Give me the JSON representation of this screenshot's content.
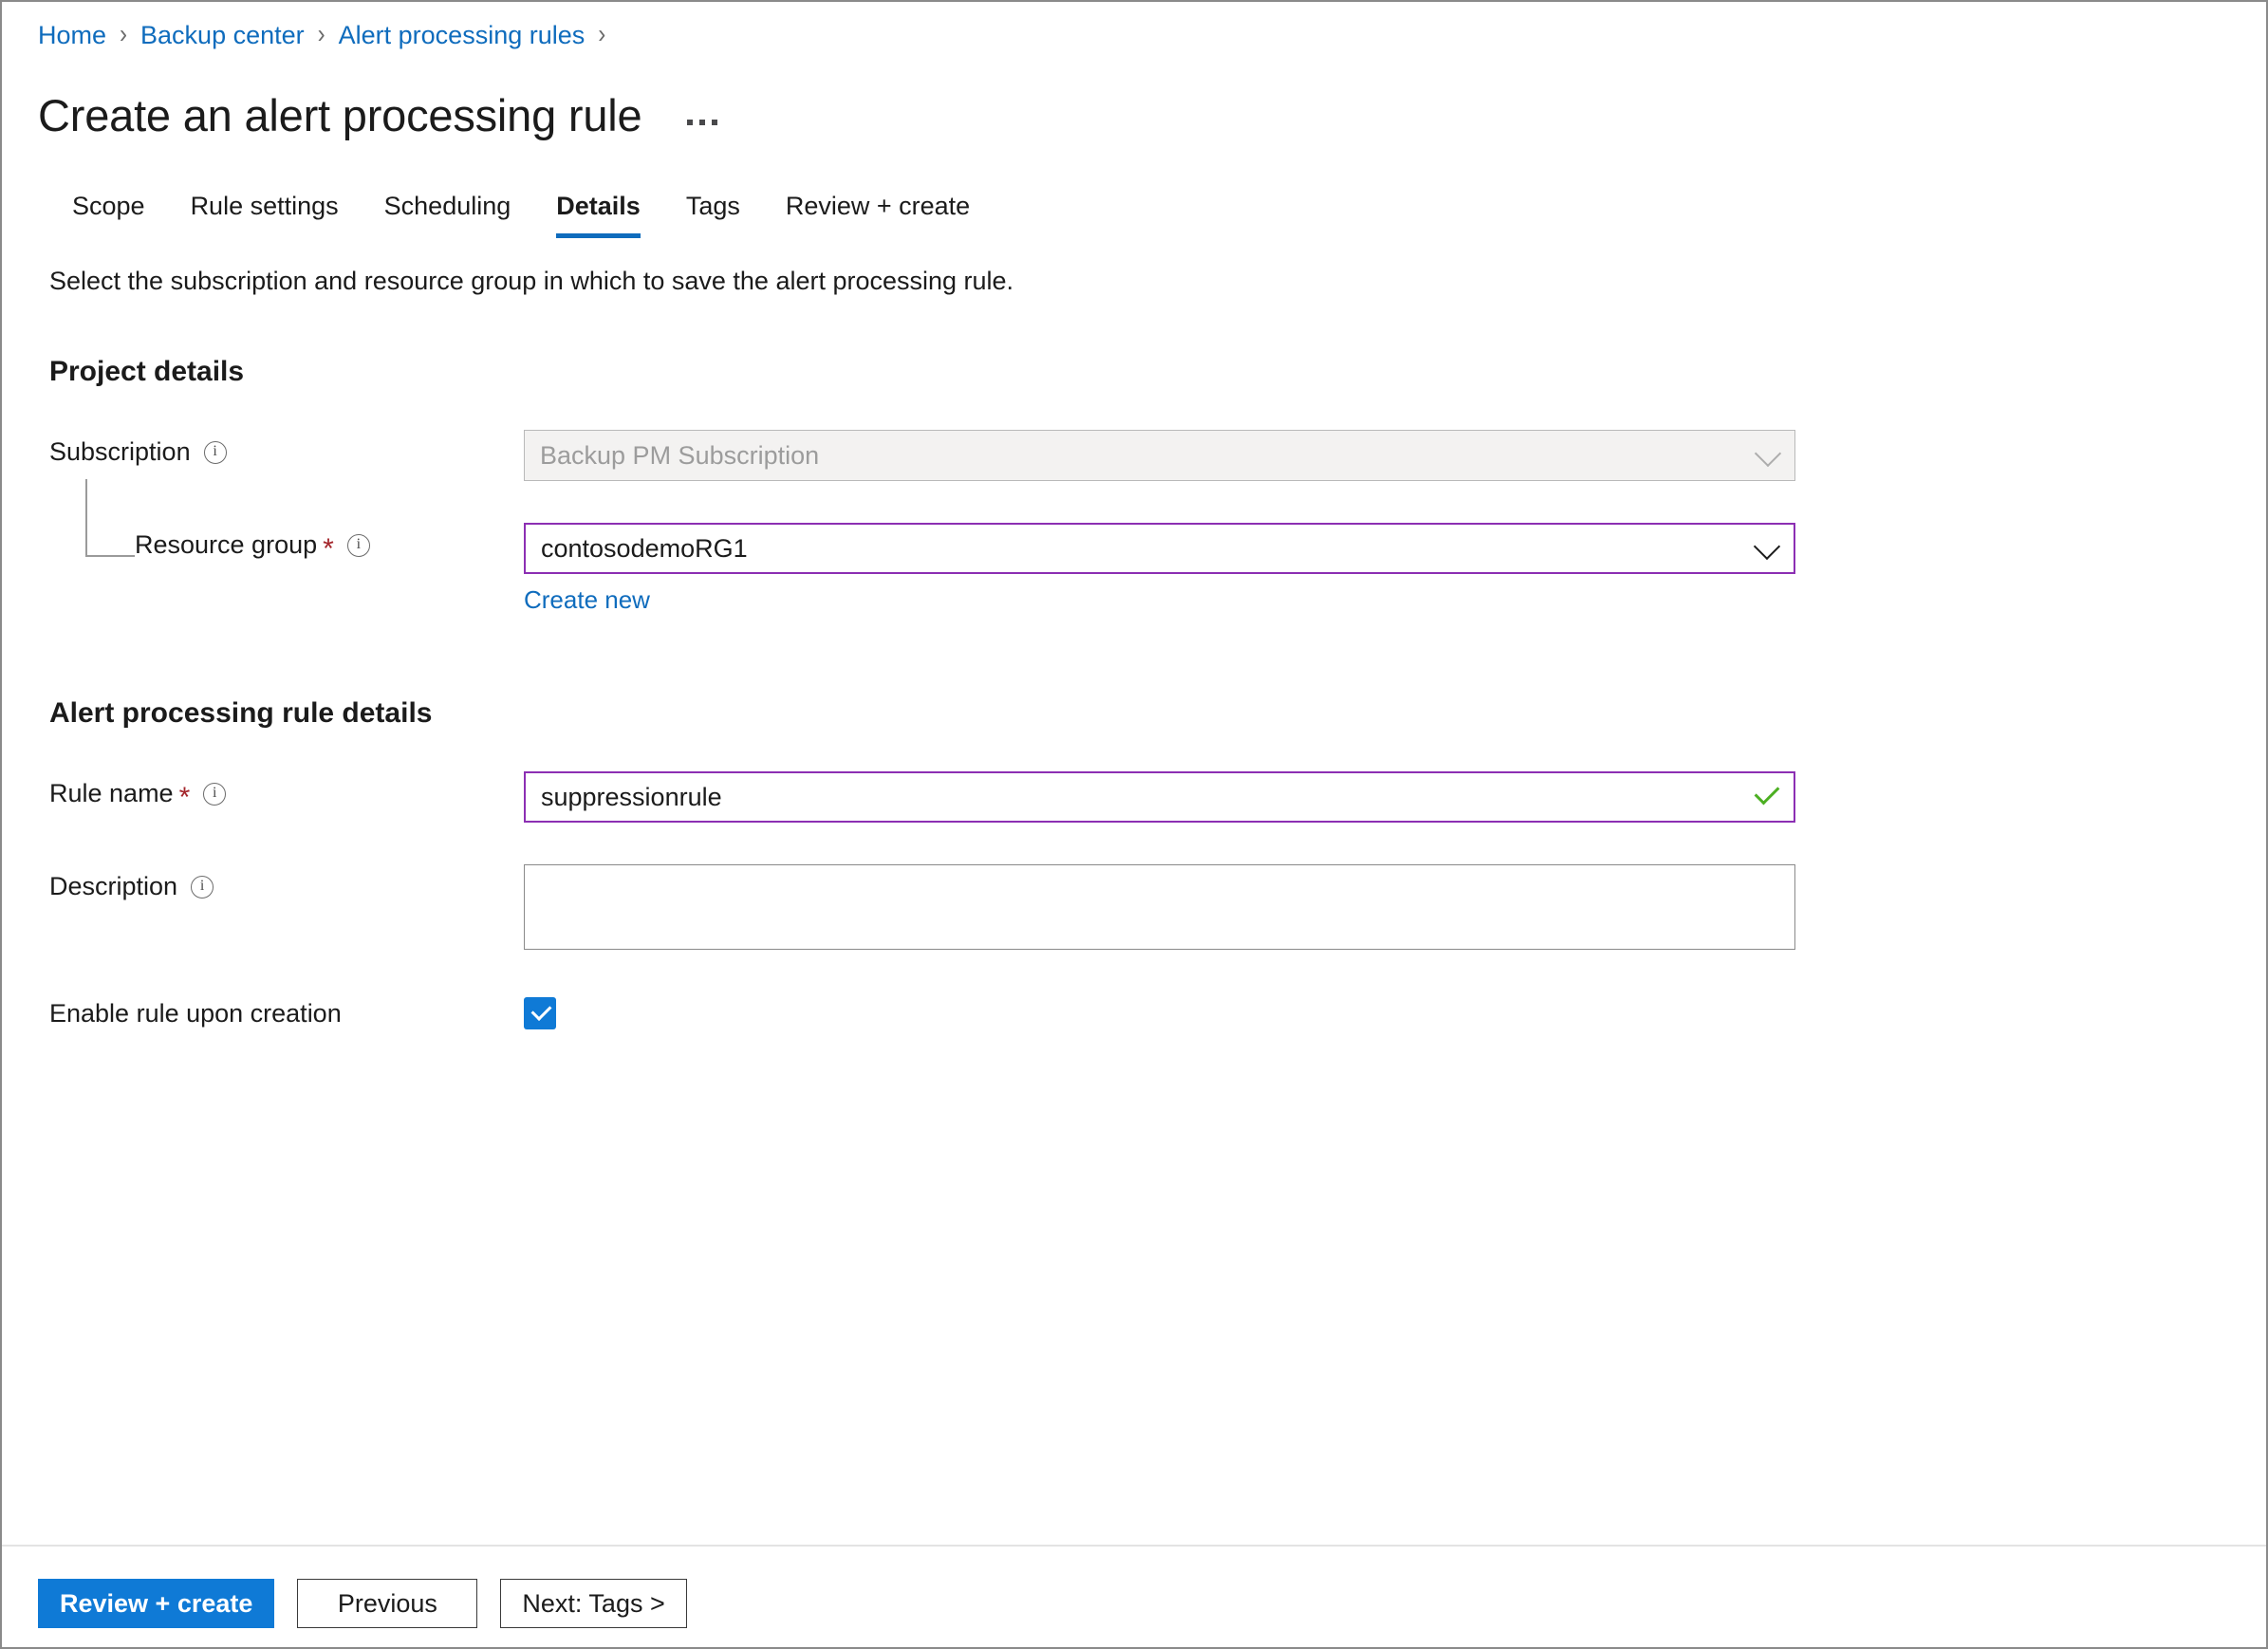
{
  "breadcrumb": {
    "items": [
      {
        "label": "Home"
      },
      {
        "label": "Backup center"
      },
      {
        "label": "Alert processing rules"
      }
    ],
    "separator": "›"
  },
  "header": {
    "title": "Create an alert processing rule",
    "more_menu": "more-options"
  },
  "tabs": [
    {
      "label": "Scope",
      "active": false
    },
    {
      "label": "Rule settings",
      "active": false
    },
    {
      "label": "Scheduling",
      "active": false
    },
    {
      "label": "Details",
      "active": true
    },
    {
      "label": "Tags",
      "active": false
    },
    {
      "label": "Review + create",
      "active": false
    }
  ],
  "intro": "Select the subscription and resource group in which to save the alert processing rule.",
  "sections": {
    "project_details": {
      "heading": "Project details",
      "subscription": {
        "label": "Subscription",
        "value": "Backup PM Subscription",
        "disabled": true
      },
      "resource_group": {
        "label": "Resource group",
        "required_marker": "*",
        "value": "contosodemoRG1",
        "create_new_label": "Create new"
      }
    },
    "rule_details": {
      "heading": "Alert processing rule details",
      "rule_name": {
        "label": "Rule name",
        "required_marker": "*",
        "value": "suppressionrule",
        "valid": true
      },
      "description": {
        "label": "Description",
        "value": "",
        "placeholder": ""
      },
      "enable_rule": {
        "label": "Enable rule upon creation",
        "checked": true
      }
    }
  },
  "footer": {
    "review_create": "Review + create",
    "previous": "Previous",
    "next": "Next: Tags >"
  },
  "colors": {
    "link": "#0f6cbd",
    "primary_button": "#0f7ad6",
    "focus_border": "#8c2fb3",
    "required_star": "#a4262c",
    "valid_check": "#4caf22",
    "checkbox": "#0f7ad6"
  }
}
